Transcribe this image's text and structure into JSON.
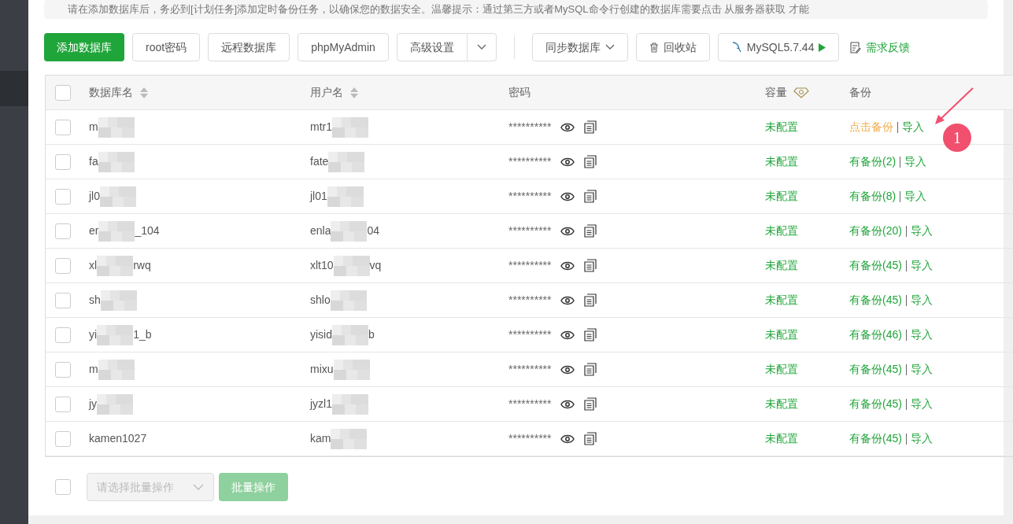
{
  "notice": "请在添加数据库后，务必到[计划任务]添加定时备份任务，以确保您的数据安全。温馨提示：通过第三方或者MySQL命令行创建的数据库需要点击 从服务器获取 才能",
  "toolbar": [
    {
      "kind": "primary",
      "label": "添加数据库"
    },
    {
      "kind": "plain",
      "label": "root密码"
    },
    {
      "kind": "plain",
      "label": "远程数据库"
    },
    {
      "kind": "plain",
      "label": "phpMyAdmin"
    },
    {
      "kind": "split",
      "label": "高级设置"
    },
    {
      "kind": "divider"
    },
    {
      "kind": "dropdown",
      "label": "同步数据库"
    },
    {
      "kind": "trash",
      "label": "回收站"
    },
    {
      "kind": "mysql",
      "label": "MySQL5.7.44"
    },
    {
      "kind": "feedback",
      "label": "需求反馈"
    }
  ],
  "table": {
    "all_checked": false,
    "columns": [
      {
        "label": "数据库名",
        "sortable": true
      },
      {
        "label": "用户名",
        "sortable": true
      },
      {
        "label": "密码",
        "sortable": false
      },
      {
        "label": "容量",
        "sortable": false
      },
      {
        "label": "备份",
        "sortable": false
      }
    ],
    "rows": [
      {
        "checked": false,
        "name": {
          "text": "m",
          "redacted": true
        },
        "user": {
          "text": "mtr1",
          "redacted": true
        },
        "password": "**********",
        "capacity": "未配置",
        "backup": "点击备份",
        "has_backup": false,
        "import": "导入"
      },
      {
        "checked": false,
        "name": {
          "text": "fa",
          "redacted": true
        },
        "user": {
          "text": "fate",
          "redacted": true
        },
        "password": "**********",
        "capacity": "未配置",
        "backup": "有备份(2)",
        "has_backup": true,
        "import": "导入"
      },
      {
        "checked": false,
        "name": {
          "text": "jl0",
          "redacted": true
        },
        "user": {
          "text": "jl01",
          "redacted": true
        },
        "password": "**********",
        "capacity": "未配置",
        "backup": "有备份(8)",
        "has_backup": true,
        "import": "导入"
      },
      {
        "checked": false,
        "name": {
          "text": "er",
          "redacted": true,
          "tail": "_104"
        },
        "user": {
          "text": "enla",
          "redacted": true,
          "tail": "04"
        },
        "password": "**********",
        "capacity": "未配置",
        "backup": "有备份(20)",
        "has_backup": true,
        "import": "导入"
      },
      {
        "checked": false,
        "name": {
          "text": "xl",
          "redacted": true,
          "tail": "rwq"
        },
        "user": {
          "text": "xlt10",
          "redacted": true,
          "tail": "vq"
        },
        "password": "**********",
        "capacity": "未配置",
        "backup": "有备份(45)",
        "has_backup": true,
        "import": "导入"
      },
      {
        "checked": false,
        "name": {
          "text": "sh",
          "redacted": true
        },
        "user": {
          "text": "shlo",
          "redacted": true
        },
        "password": "**********",
        "capacity": "未配置",
        "backup": "有备份(45)",
        "has_backup": true,
        "import": "导入"
      },
      {
        "checked": false,
        "name": {
          "text": "yi",
          "redacted": true,
          "tail": "1_b"
        },
        "user": {
          "text": "yisid",
          "redacted": true,
          "tail": "b"
        },
        "password": "**********",
        "capacity": "未配置",
        "backup": "有备份(46)",
        "has_backup": true,
        "import": "导入"
      },
      {
        "checked": false,
        "name": {
          "text": "m",
          "redacted": true
        },
        "user": {
          "text": "mixu",
          "redacted": true
        },
        "password": "**********",
        "capacity": "未配置",
        "backup": "有备份(45)",
        "has_backup": true,
        "import": "导入"
      },
      {
        "checked": false,
        "name": {
          "text": "jy",
          "redacted": true
        },
        "user": {
          "text": "jyzl1",
          "redacted": true
        },
        "password": "**********",
        "capacity": "未配置",
        "backup": "有备份(45)",
        "has_backup": true,
        "import": "导入"
      },
      {
        "checked": false,
        "name": {
          "text": "kamen1027",
          "redacted": false
        },
        "user": {
          "text": "kam",
          "redacted": true
        },
        "password": "**********",
        "capacity": "未配置",
        "backup": "有备份(45)",
        "has_backup": true,
        "import": "导入"
      }
    ]
  },
  "annotation": {
    "label": "1"
  },
  "footer": {
    "checked": false,
    "select_placeholder": "请选择批量操作",
    "button": "批量操作",
    "button_disabled": true
  }
}
